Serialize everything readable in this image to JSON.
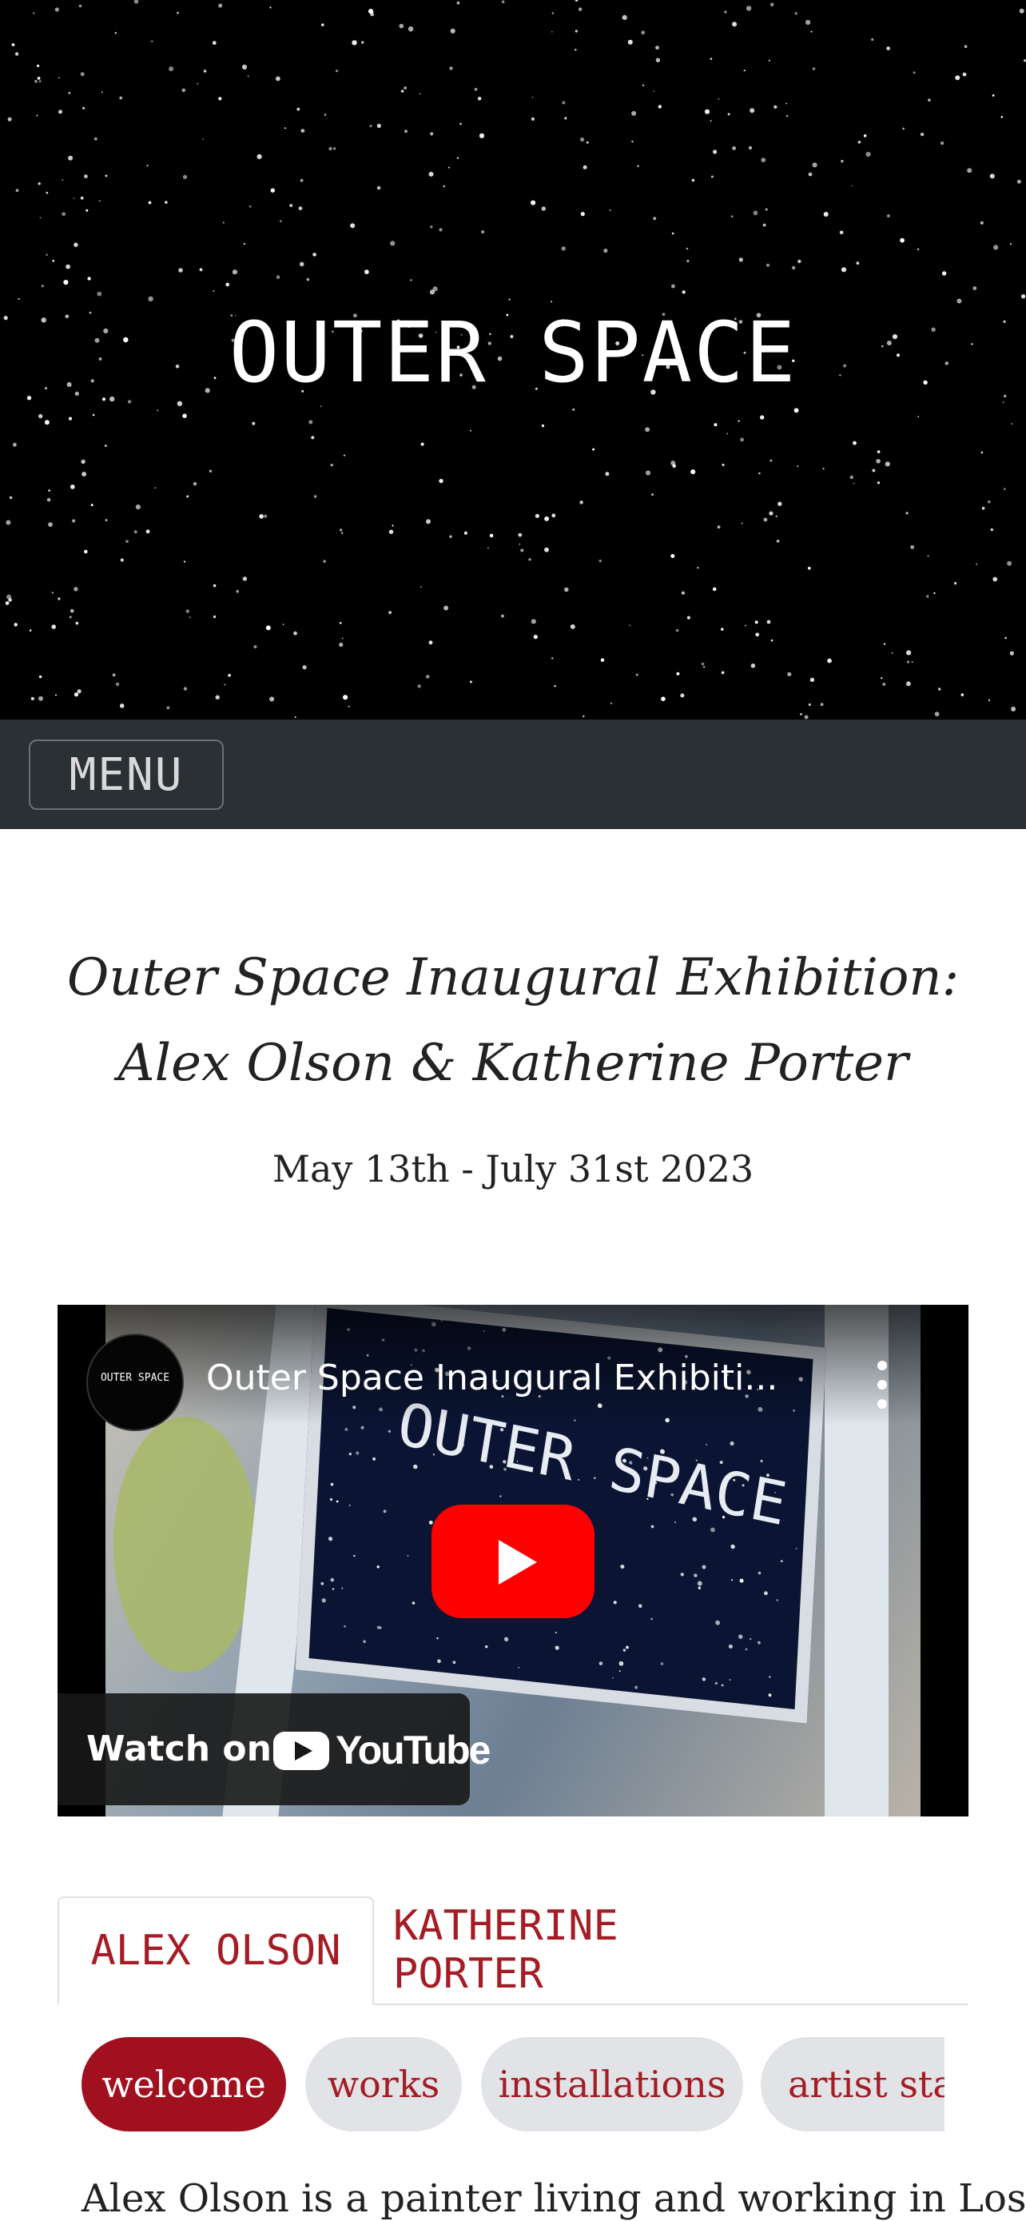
{
  "hero": {
    "title": "OUTER SPACE"
  },
  "nav": {
    "menu_label": "MENU"
  },
  "exhibition": {
    "title_line1": "Outer Space Inaugural Exhibition:",
    "title_line2": "Alex Olson & Katherine Porter",
    "dates": "May 13th - July 31st 2023"
  },
  "video": {
    "title": "Outer Space Inaugural Exhibiti...",
    "channel_name": "OUTER SPACE",
    "sign_text": "OUTER SPACE",
    "watch_on": "Watch on",
    "platform": "YouTube"
  },
  "tabs": [
    {
      "label": "ALEX OLSON",
      "active": true
    },
    {
      "label": "KATHERINE PORTER",
      "active": false
    }
  ],
  "pills": [
    {
      "label": "welcome",
      "active": true
    },
    {
      "label": "works",
      "active": false
    },
    {
      "label": "installations",
      "active": false
    },
    {
      "label": "artist stat",
      "active": false
    }
  ],
  "body": {
    "intro": "Alex Olson is a painter living and working in Los"
  },
  "colors": {
    "accent": "#a0101e",
    "navbar": "#2b3035",
    "pill_idle": "#e1e3e6"
  }
}
